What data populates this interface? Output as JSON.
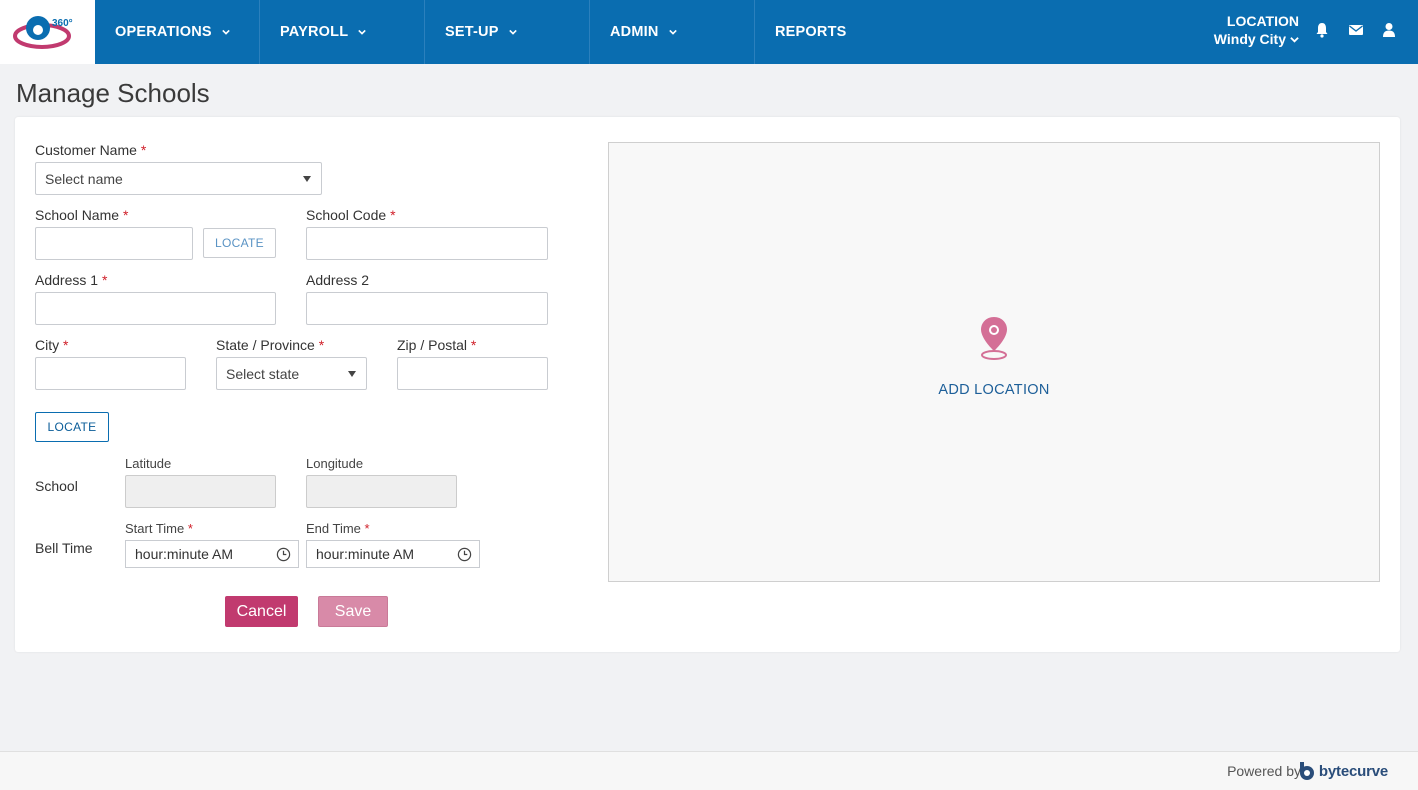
{
  "nav": {
    "items": [
      {
        "label": "OPERATIONS",
        "has_menu": true
      },
      {
        "label": "PAYROLL",
        "has_menu": true
      },
      {
        "label": "SET-UP",
        "has_menu": true
      },
      {
        "label": "ADMIN",
        "has_menu": true
      },
      {
        "label": "REPORTS",
        "has_menu": false
      }
    ],
    "location_label": "LOCATION",
    "location_value": "Windy City",
    "icons": [
      "bell-icon",
      "envelope-icon",
      "user-icon"
    ],
    "logo_text": "360°"
  },
  "page": {
    "title": "Manage Schools"
  },
  "form": {
    "customer_name_label": "Customer Name",
    "customer_name_placeholder": "Select name",
    "school_name_label": "School Name",
    "locate_small": "LOCATE",
    "school_code_label": "School Code",
    "address1_label": "Address 1",
    "address2_label": "Address 2",
    "city_label": "City",
    "state_label": "State / Province",
    "state_placeholder": "Select state",
    "zip_label": "Zip / Postal",
    "locate_button": "LOCATE",
    "school_label": "School",
    "latitude_label": "Latitude",
    "longitude_label": "Longitude",
    "bell_time_label": "Bell Time",
    "start_time_label": "Start Time",
    "end_time_label": "End Time",
    "start_time_placeholder": "hour:minute AM",
    "end_time_placeholder": "hour:minute AM",
    "required_mark": "*",
    "cancel_label": "Cancel",
    "save_label": "Save"
  },
  "map": {
    "add_location_label": "ADD LOCATION"
  },
  "footer": {
    "powered_by": "Powered by",
    "brand": "bytecurve"
  },
  "colors": {
    "nav_bg": "#0a6db0",
    "accent_pink": "#c13a6f",
    "link_blue": "#1d5f99",
    "required": "#d0202a"
  }
}
